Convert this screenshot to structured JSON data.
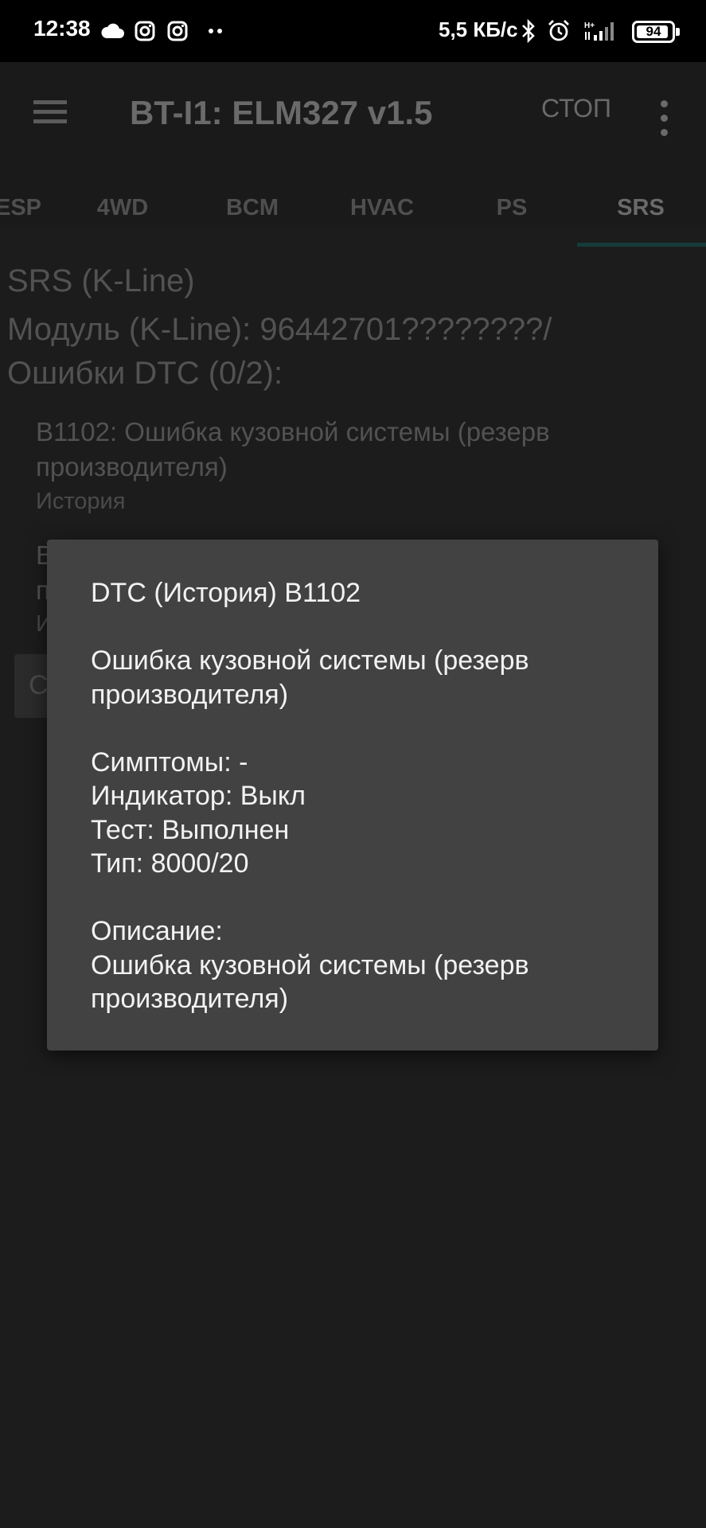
{
  "status_bar": {
    "time": "12:38",
    "net_speed": "5,5 КБ/с",
    "battery": "94",
    "battery_level": 0.94,
    "icons": [
      "cloud-icon",
      "instagram-icon",
      "instagram-icon",
      "more-dots-icon",
      "bluetooth-icon",
      "alarm-icon",
      "signal-icon"
    ]
  },
  "app_bar": {
    "title": "BT-I1: ELM327 v1.5",
    "stop_label": "СТОП"
  },
  "tabs": [
    {
      "label": "ESP"
    },
    {
      "label": "4WD"
    },
    {
      "label": "BCM"
    },
    {
      "label": "HVAC"
    },
    {
      "label": "PS"
    },
    {
      "label": "SRS",
      "active": true
    }
  ],
  "content": {
    "section_title": "SRS (K-Line)",
    "module_line": "Модуль (K-Line): 96442701????????/",
    "errors_line": "Ошибки DTC (0/2):",
    "dtc_items": [
      {
        "title": "B1102: Ошибка кузовной системы (резерв производителя)",
        "status": "История"
      }
    ],
    "peek_chars": [
      "B",
      "п",
      "И"
    ],
    "peek_button": "С"
  },
  "dialog": {
    "title": "DTC (История) B1102",
    "name": "Ошибка кузовной системы (резерв производителя)",
    "symptoms": "Симптомы: -",
    "indicator": "Индикатор: Выкл",
    "test": "Тест: Выполнен",
    "type": "Тип: 8000/20",
    "desc_label": "Описание:",
    "desc_text": "Ошибка кузовной системы (резерв производителя)"
  },
  "colors": {
    "background": "#1c1c1c",
    "dialog": "#424242",
    "accent_indicator": "#143c3a"
  }
}
